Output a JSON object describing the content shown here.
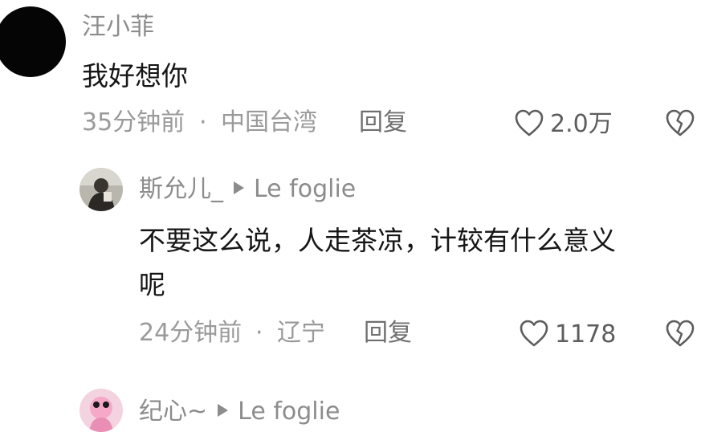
{
  "top_comment": {
    "username": "汪小菲",
    "text": "我好想你",
    "time": "35分钟前",
    "separator": "·",
    "location": "中国台湾",
    "reply_label": "回复",
    "likes": "2.0万",
    "icons": {
      "avatar": "black-avatar",
      "like": "heart-outline-icon",
      "dislike": "broken-heart-icon"
    }
  },
  "replies": [
    {
      "username": "斯允儿_",
      "arrow": "▶",
      "reply_to": "Le foglie",
      "text_line1": "不要这么说，人走茶凉，计较有什么意义",
      "text_line2": "呢",
      "time": "24分钟前",
      "separator": "·",
      "location": "辽宁",
      "reply_label": "回复",
      "likes": "1178"
    },
    {
      "username": "纪心~",
      "arrow": "▶",
      "reply_to": "Le foglie"
    }
  ],
  "colors": {
    "background": "#ffffff",
    "meta_text": "#9a9a9a",
    "username_text": "#8c8c8c",
    "comment_text": "#161616",
    "icon_stroke": "#5d5d5d"
  }
}
